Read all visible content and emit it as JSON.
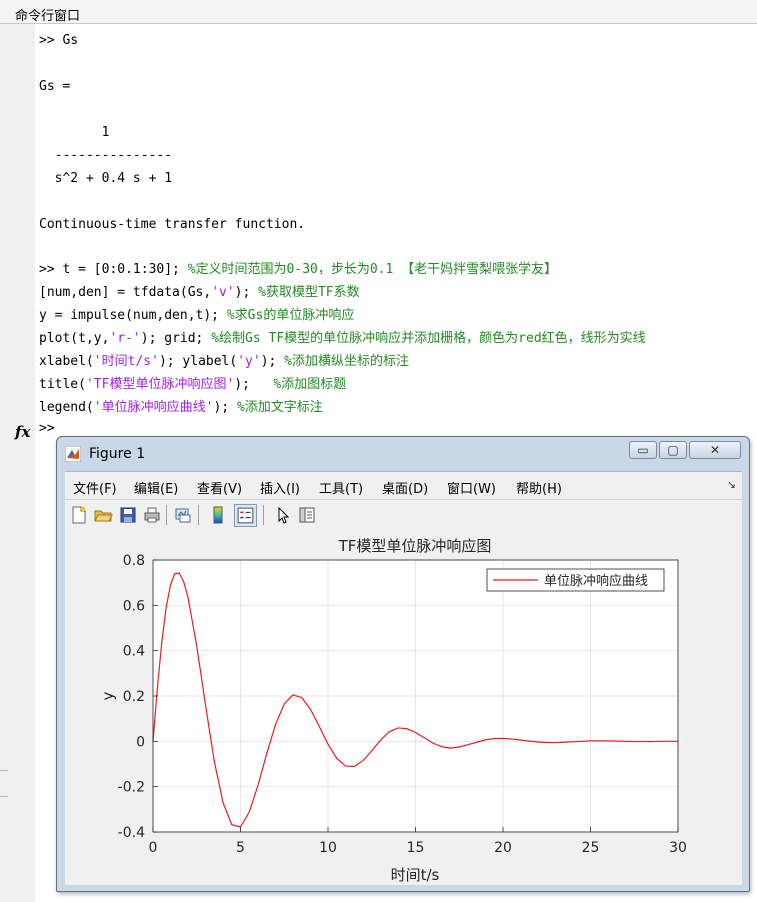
{
  "pane": {
    "title": "命令行窗口"
  },
  "lines": [
    {
      "id": "l1",
      "parts": [
        {
          "t": ">> Gs",
          "k": "n"
        }
      ]
    },
    {
      "id": "l2",
      "parts": [
        {
          "t": "Gs =",
          "k": "n"
        }
      ]
    },
    {
      "id": "l3",
      "parts": [
        {
          "t": "        1",
          "k": "n"
        }
      ]
    },
    {
      "id": "l4",
      "parts": [
        {
          "t": "  ---------------",
          "k": "n"
        }
      ]
    },
    {
      "id": "l5",
      "parts": [
        {
          "t": "  s^2 + 0.4 s + 1",
          "k": "n"
        }
      ]
    },
    {
      "id": "l6",
      "parts": [
        {
          "t": "Continuous-time transfer function.",
          "k": "n"
        }
      ]
    },
    {
      "id": "l7",
      "parts": [
        {
          "t": ">> t = [0:0.1:30]; ",
          "k": "n"
        },
        {
          "t": "%定义时间范围为0-30，步长为0.1 【老干妈拌雪梨喂张学友】",
          "k": "c"
        }
      ]
    },
    {
      "id": "l8",
      "parts": [
        {
          "t": "[num,den] = tfdata(Gs,",
          "k": "n"
        },
        {
          "t": "'v'",
          "k": "s"
        },
        {
          "t": "); ",
          "k": "n"
        },
        {
          "t": "%获取模型TF系数",
          "k": "c"
        }
      ]
    },
    {
      "id": "l9",
      "parts": [
        {
          "t": "y = impulse(num,den,t); ",
          "k": "n"
        },
        {
          "t": "%求Gs的单位脉冲响应",
          "k": "c"
        }
      ]
    },
    {
      "id": "l10",
      "parts": [
        {
          "t": "plot(t,y,",
          "k": "n"
        },
        {
          "t": "'r-'",
          "k": "s"
        },
        {
          "t": "); grid; ",
          "k": "n"
        },
        {
          "t": "%绘制Gs TF模型的单位脉冲响应并添加栅格，颜色为red红色，线形为实线",
          "k": "c"
        }
      ]
    },
    {
      "id": "l11",
      "parts": [
        {
          "t": "xlabel(",
          "k": "n"
        },
        {
          "t": "'时间t/s'",
          "k": "s"
        },
        {
          "t": "); ylabel(",
          "k": "n"
        },
        {
          "t": "'y'",
          "k": "s"
        },
        {
          "t": "); ",
          "k": "n"
        },
        {
          "t": "%添加横纵坐标的标注",
          "k": "c"
        }
      ]
    },
    {
      "id": "l12",
      "parts": [
        {
          "t": "title(",
          "k": "n"
        },
        {
          "t": "'TF模型单位脉冲响应图'",
          "k": "s"
        },
        {
          "t": ");   ",
          "k": "n"
        },
        {
          "t": "%添加图标题",
          "k": "c"
        }
      ]
    },
    {
      "id": "l13",
      "parts": [
        {
          "t": "legend(",
          "k": "n"
        },
        {
          "t": "'单位脉冲响应曲线'",
          "k": "s"
        },
        {
          "t": "); ",
          "k": "n"
        },
        {
          "t": "%添加文字标注",
          "k": "c"
        }
      ]
    }
  ],
  "prompt": ">>",
  "fx_label": "fx",
  "figure": {
    "title": "Figure 1",
    "buttons": {
      "minimize": "▭",
      "maximize": "▢",
      "close": "✕"
    },
    "menus": [
      "文件(F)",
      "编辑(E)",
      "查看(V)",
      "插入(I)",
      "工具(T)",
      "桌面(D)",
      "窗口(W)",
      "帮助(H)"
    ],
    "menu_overflow": "↘",
    "tools": [
      "new-file-icon",
      "open-folder-icon",
      "save-icon",
      "print-icon",
      "link-plot-icon",
      "colorbar-icon",
      "legend-icon",
      "pointer-icon",
      "property-inspector-icon"
    ]
  },
  "colors": {
    "comment": "#228B22",
    "string": "#a020f0",
    "line": "#e81e1e",
    "axes_bg": "#ffffff",
    "figure_bg": "#f0f0f0"
  },
  "chart_data": {
    "type": "line",
    "title": "TF模型单位脉冲响应图",
    "xlabel": "时间t/s",
    "ylabel": "y",
    "xlim": [
      0,
      30
    ],
    "ylim": [
      -0.4,
      0.8
    ],
    "xticks": [
      0,
      5,
      10,
      15,
      20,
      25,
      30
    ],
    "yticks": [
      -0.4,
      -0.2,
      0,
      0.2,
      0.4,
      0.6,
      0.8
    ],
    "grid": true,
    "legend_position": "top-right",
    "series": [
      {
        "name": "单位脉冲响应曲线",
        "color": "#e81e1e",
        "x": [
          0,
          0.25,
          0.5,
          0.75,
          1,
          1.25,
          1.5,
          1.75,
          2,
          2.5,
          3,
          3.5,
          4,
          4.5,
          5,
          5.5,
          6,
          6.5,
          7,
          7.5,
          8,
          8.5,
          9,
          9.5,
          10,
          10.5,
          11,
          11.5,
          12,
          12.5,
          13,
          13.5,
          14,
          14.5,
          15,
          15.5,
          16,
          16.5,
          17,
          17.5,
          18,
          18.5,
          19,
          19.5,
          20,
          20.5,
          21,
          21.5,
          22,
          22.5,
          23,
          23.5,
          24,
          24.5,
          25,
          25.5,
          26,
          26.5,
          27,
          27.5,
          28,
          28.5,
          29,
          29.5,
          30
        ],
        "y": [
          0,
          0.235,
          0.435,
          0.59,
          0.69,
          0.74,
          0.742,
          0.705,
          0.635,
          0.42,
          0.161,
          -0.087,
          -0.27,
          -0.368,
          -0.378,
          -0.312,
          -0.194,
          -0.054,
          0.074,
          0.165,
          0.205,
          0.193,
          0.141,
          0.066,
          -0.013,
          -0.075,
          -0.109,
          -0.111,
          -0.085,
          -0.042,
          0.005,
          0.042,
          0.059,
          0.056,
          0.039,
          0.016,
          -0.008,
          -0.024,
          -0.03,
          -0.025,
          -0.015,
          -0.004,
          0.007,
          0.012,
          0.013,
          0.01,
          0.006,
          0.001,
          -0.003,
          -0.005,
          -0.006,
          -0.004,
          -0.002,
          0,
          0.002,
          0.002,
          0.002,
          0.001,
          0,
          -0.001,
          -0.001,
          -0.001,
          0,
          0,
          0
        ]
      }
    ]
  }
}
